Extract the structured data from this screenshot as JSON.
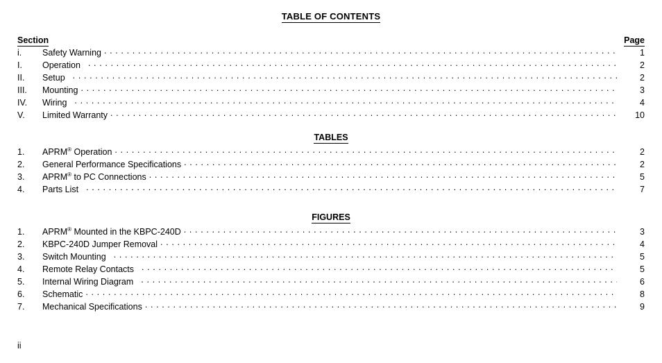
{
  "document": {
    "title": "TABLE OF CONTENTS",
    "folio": "ii"
  },
  "columns": {
    "section_header": "Section",
    "page_header": "Page"
  },
  "sections": {
    "entries": [
      {
        "number": "i.",
        "label": "Safety Warning",
        "page": "1",
        "gap": false
      },
      {
        "number": "I.",
        "label": "Operation",
        "page": "2",
        "gap": true
      },
      {
        "number": "II.",
        "label": "Setup",
        "page": "2",
        "gap": true
      },
      {
        "number": "III.",
        "label": "Mounting",
        "page": "3",
        "gap": false
      },
      {
        "number": "IV.",
        "label": "Wiring",
        "page": "4",
        "gap": true
      },
      {
        "number": "V.",
        "label": "Limited Warranty",
        "page": "10",
        "gap": false
      }
    ]
  },
  "tables": {
    "heading": "TABLES",
    "entries": [
      {
        "number": "1.",
        "label": "APRM",
        "sup": "®",
        "label_after": " Operation",
        "page": "2",
        "gap": false
      },
      {
        "number": "2.",
        "label": "General Performance Specifications",
        "sup": "",
        "label_after": "",
        "page": "2",
        "gap": false
      },
      {
        "number": "3.",
        "label": "APRM",
        "sup": "®",
        "label_after": " to PC Connections",
        "page": "5",
        "gap": false
      },
      {
        "number": "4.",
        "label": "Parts List",
        "sup": "",
        "label_after": "",
        "page": "7",
        "gap": true
      }
    ]
  },
  "figures": {
    "heading": "FIGURES",
    "entries": [
      {
        "number": "1.",
        "label": "APRM",
        "sup": "®",
        "label_after": " Mounted in the KBPC-240D",
        "page": "3",
        "gap": false
      },
      {
        "number": "2.",
        "label": "KBPC-240D Jumper Removal",
        "sup": "",
        "label_after": "",
        "page": "4",
        "gap": false
      },
      {
        "number": "3.",
        "label": "Switch Mounting",
        "sup": "",
        "label_after": "",
        "page": "5",
        "gap": true
      },
      {
        "number": "4.",
        "label": "Remote Relay Contacts",
        "sup": "",
        "label_after": "",
        "page": "5",
        "gap": true
      },
      {
        "number": "5.",
        "label": "Internal Wiring Diagram",
        "sup": "",
        "label_after": "",
        "page": "6",
        "gap": true
      },
      {
        "number": "6.",
        "label": "Schematic",
        "sup": "",
        "label_after": "",
        "page": "8",
        "gap": false
      },
      {
        "number": "7.",
        "label": "Mechanical Specifications",
        "sup": "",
        "label_after": "",
        "page": "9",
        "gap": false
      }
    ]
  }
}
